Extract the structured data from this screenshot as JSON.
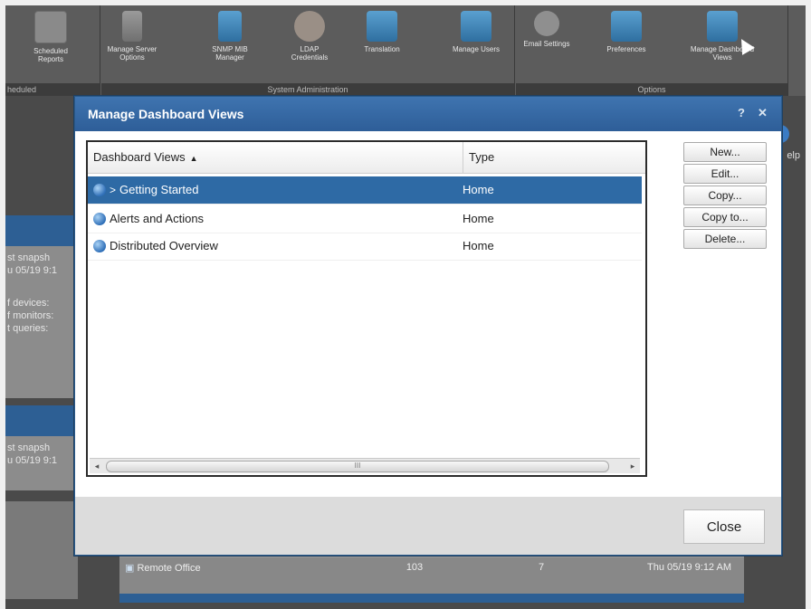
{
  "ribbon": {
    "left_group": {
      "label": "heduled",
      "buttons": [
        {
          "label": "Scheduled Reports",
          "icon": "report-icon"
        }
      ]
    },
    "admin_group": {
      "label": "System Administration",
      "buttons": [
        {
          "label": "Manage Server Options",
          "icon": "server-icon"
        },
        {
          "label": "SNMP MIB Manager",
          "icon": "mib-icon"
        },
        {
          "label": "LDAP Credentials",
          "icon": "certificate-icon"
        },
        {
          "label": "Translation",
          "icon": "translation-icon"
        },
        {
          "label": "Manage Users",
          "icon": "users-icon"
        }
      ]
    },
    "options_group": {
      "label": "Options",
      "buttons": [
        {
          "label": "Email Settings",
          "icon": "email-icon"
        },
        {
          "label": "Preferences",
          "icon": "preferences-icon"
        },
        {
          "label": "Manage Dashboard Views",
          "icon": "dashboard-views-icon"
        }
      ]
    }
  },
  "background": {
    "side_lines_1": [
      "st snapsh",
      "u 05/19 9:1",
      "f devices:",
      "f monitors:",
      "t queries:"
    ],
    "side_lines_2": [
      "st snapsh",
      "u 05/19 9:1"
    ],
    "help_label": "elp",
    "table": {
      "rows": [
        {
          "name": "Remote Office",
          "up": "103",
          "down": "7",
          "last": "Thu 05/19 9:12 AM"
        }
      ]
    }
  },
  "dialog": {
    "title": "Manage Dashboard Views",
    "help_glyph": "?",
    "close_glyph": "✕",
    "columns": {
      "name": "Dashboard Views",
      "sort_indicator": "▲",
      "type": "Type"
    },
    "rows": [
      {
        "prefix": ">",
        "name": "Getting Started",
        "type": "Home",
        "selected": true
      },
      {
        "prefix": "",
        "name": "Alerts and Actions",
        "type": "Home",
        "selected": false
      },
      {
        "prefix": "",
        "name": "Distributed Overview",
        "type": "Home",
        "selected": false
      }
    ],
    "scrollbar": {
      "left_arrow": "◂",
      "right_arrow": "▸",
      "grip": "III"
    },
    "buttons": {
      "new": "New...",
      "edit": "Edit...",
      "copy": "Copy...",
      "copy_to": "Copy to...",
      "delete": "Delete..."
    },
    "close": "Close"
  },
  "colors": {
    "titlebar": "#2e5e98",
    "selection": "#2e6aa5",
    "background_dim": "#4a4a4a"
  }
}
